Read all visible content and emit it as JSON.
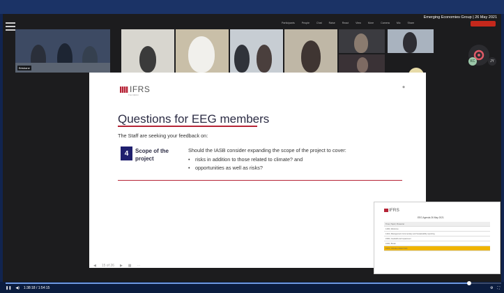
{
  "meeting": {
    "title": "Emerging Economies Group | 26 May 2021",
    "leave_label": "",
    "header_items": [
      "Participants",
      "People",
      "Chat",
      "Raise",
      "React",
      "View",
      "More",
      "Camera",
      "Mic",
      "Share"
    ]
  },
  "participants": {
    "tiles": [
      {
        "tag": "Brisbane",
        "bg": "#3d4a63"
      },
      {
        "tag": "",
        "bg": "#d8d6cf"
      },
      {
        "tag": "",
        "bg": "#c9bfa8"
      },
      {
        "tag": "",
        "bg": "#c7cdd3"
      },
      {
        "tag": "",
        "bg": "#bfb7a6"
      },
      {
        "tag": "",
        "bg": "#3b3b40"
      },
      {
        "tag": "",
        "bg": "#a9b3bf"
      }
    ],
    "avatar_initials": "IW",
    "badge_initials": "KC",
    "badge2_initials": "JY"
  },
  "slide": {
    "logo_text": "IFRS",
    "logo_sub": "Foundation",
    "title": "Questions for EEG members",
    "intro": "The Staff are seeking your feedback on:",
    "item_number": "4",
    "item_label": "Scope of the project",
    "question": "Should the IASB consider expanding the scope of the project to cover:",
    "bullets": [
      "risks in addition to those related to climate? and",
      "opportunities as well as risks?"
    ]
  },
  "agenda_thumbnail": {
    "logo_text": "IFRS",
    "title": "EEG Agenda 26 May 2021",
    "rows": [
      "Time | Topic | Presenter",
      "1400 | Welcome",
      "1410 | Management Commentary and Sustainability reporting",
      "1500 | Goodwill and Impairment",
      "1600 | Break",
      "1615 | Climate-related risks"
    ],
    "highlight_index": 5
  },
  "slide_toolbar": {
    "page": "15 of 26",
    "items": [
      "Previous",
      "Next",
      "Grid",
      "More"
    ]
  },
  "player": {
    "elapsed": "1:38:18 / 1:54:15",
    "progress": 0.935
  },
  "colors": {
    "ifrs_red": "#b52335",
    "navy_box": "#1f1f6e",
    "highlight": "#f0b400",
    "progress_fill": "#6f98e0"
  }
}
